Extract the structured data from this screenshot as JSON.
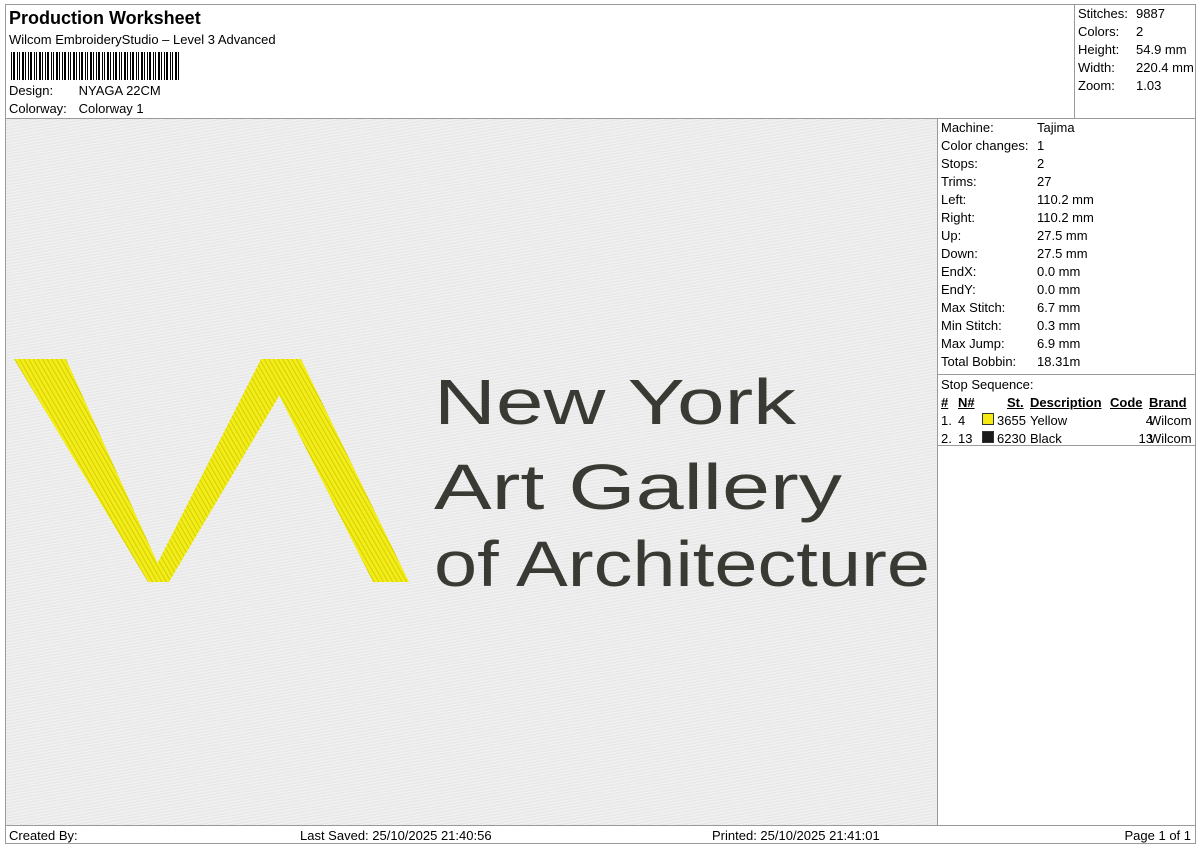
{
  "header": {
    "title": "Production Worksheet",
    "subtitle": "Wilcom EmbroideryStudio – Level 3 Advanced",
    "design_label": "Design:",
    "design_value": "NYAGA 22CM",
    "colorway_label": "Colorway:",
    "colorway_value": "Colorway 1"
  },
  "top_stats": [
    {
      "label": "Stitches:",
      "value": "9887"
    },
    {
      "label": "Colors:",
      "value": "2"
    },
    {
      "label": "Height:",
      "value": "54.9 mm"
    },
    {
      "label": "Width:",
      "value": "220.4 mm"
    },
    {
      "label": "Zoom:",
      "value": "1.03"
    }
  ],
  "machine_stats": [
    {
      "label": "Machine:",
      "value": "Tajima"
    },
    {
      "label": "Color changes:",
      "value": "1"
    },
    {
      "label": "Stops:",
      "value": "2"
    },
    {
      "label": "Trims:",
      "value": "27"
    },
    {
      "label": "Left:",
      "value": "110.2 mm"
    },
    {
      "label": "Right:",
      "value": "110.2 mm"
    },
    {
      "label": "Up:",
      "value": "27.5 mm"
    },
    {
      "label": "Down:",
      "value": "27.5 mm"
    },
    {
      "label": "EndX:",
      "value": "0.0 mm"
    },
    {
      "label": "EndY:",
      "value": "0.0 mm"
    },
    {
      "label": "Max Stitch:",
      "value": "6.7 mm"
    },
    {
      "label": "Min Stitch:",
      "value": "0.3 mm"
    },
    {
      "label": "Max Jump:",
      "value": "6.9 mm"
    },
    {
      "label": "Total Bobbin:",
      "value": "18.31m"
    }
  ],
  "stop_sequence": {
    "label": "Stop Sequence:",
    "headers": {
      "num": "#",
      "n": "N#",
      "st": "St.",
      "description": "Description",
      "code": "Code",
      "brand": "Brand"
    },
    "rows": [
      {
        "num": "1.",
        "n": "4",
        "color": "#f5eb10",
        "st": "3655",
        "description": "Yellow",
        "code": "4",
        "brand": "Wilcom"
      },
      {
        "num": "2.",
        "n": "13",
        "color": "#1a1a1a",
        "st": "6230",
        "description": "Black",
        "code": "13",
        "brand": "Wilcom"
      }
    ]
  },
  "design_text": {
    "line1": "New York",
    "line2": "Art Gallery",
    "line3": "of Architecture"
  },
  "colors": {
    "thread_yellow": "#f2ec1a",
    "thread_black": "#3a3a34",
    "canvas_bg": "#e9e9e9"
  },
  "footer": {
    "created_by": "Created By:",
    "last_saved": "Last Saved: 25/10/2025 21:40:56",
    "printed": "Printed: 25/10/2025 21:41:01",
    "page": "Page 1 of 1"
  }
}
